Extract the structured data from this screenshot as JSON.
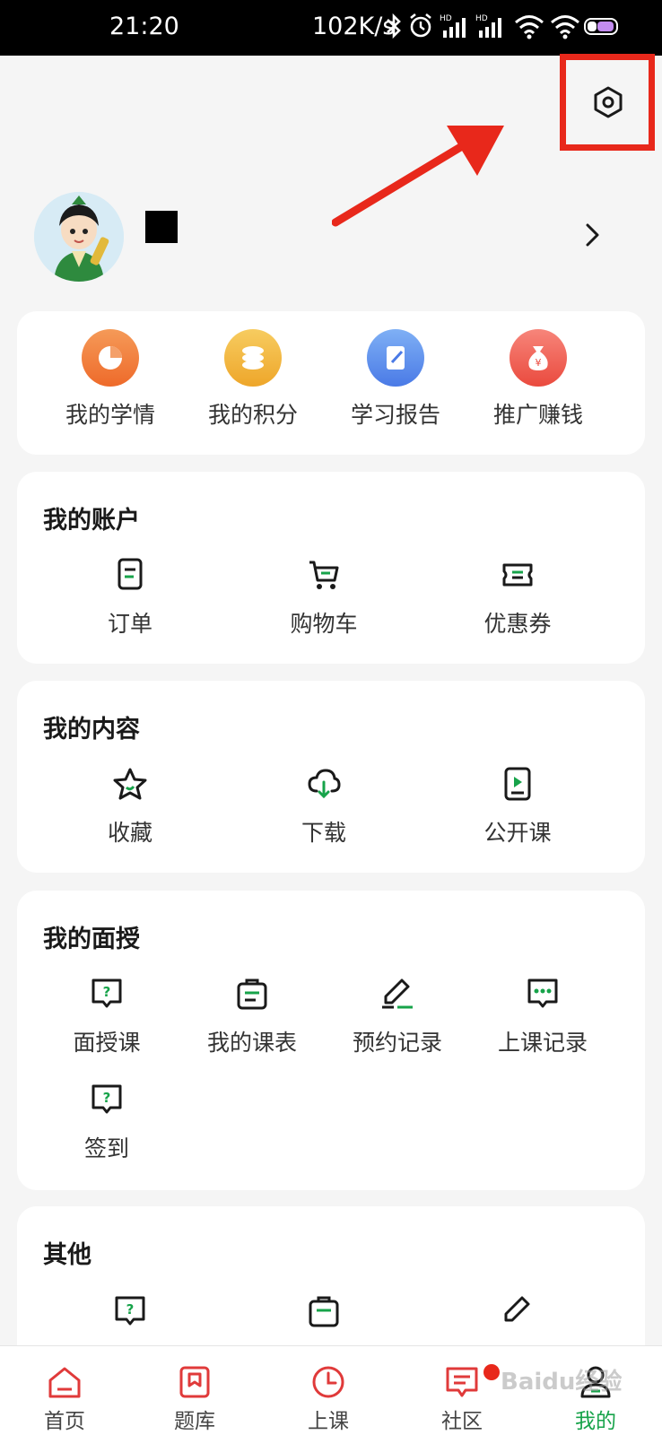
{
  "status_bar": {
    "time": "21:20",
    "speed": "102K/s",
    "icons": [
      "bluetooth-icon",
      "alarm-icon",
      "hd-signal-icon",
      "hd-signal-icon",
      "wifi-icon",
      "wifi-icon",
      "battery-icon"
    ]
  },
  "header": {
    "settings_icon": "settings-hexagon-icon",
    "annotation_color": "#e8281b"
  },
  "quick_actions": [
    {
      "label": "我的学情",
      "icon": "pie-chart-icon",
      "color": "#f07a35"
    },
    {
      "label": "我的积分",
      "icon": "coins-stack-icon",
      "color": "#f0b43a"
    },
    {
      "label": "学习报告",
      "icon": "notebook-edit-icon",
      "color": "#4f8fe8"
    },
    {
      "label": "推广赚钱",
      "icon": "money-bag-icon",
      "color": "#f05a4a"
    }
  ],
  "account": {
    "title": "我的账户",
    "items": [
      {
        "label": "订单",
        "icon": "order-document-icon"
      },
      {
        "label": "购物车",
        "icon": "shopping-cart-icon"
      },
      {
        "label": "优惠券",
        "icon": "coupon-icon"
      }
    ]
  },
  "content": {
    "title": "我的内容",
    "items": [
      {
        "label": "收藏",
        "icon": "star-icon"
      },
      {
        "label": "下载",
        "icon": "cloud-download-icon"
      },
      {
        "label": "公开课",
        "icon": "video-play-icon"
      }
    ]
  },
  "face_teaching": {
    "title": "我的面授",
    "items": [
      {
        "label": "面授课",
        "icon": "question-bubble-icon"
      },
      {
        "label": "我的课表",
        "icon": "clipboard-schedule-icon"
      },
      {
        "label": "预约记录",
        "icon": "pen-edit-icon"
      },
      {
        "label": "上课记录",
        "icon": "chat-dots-icon"
      },
      {
        "label": "签到",
        "icon": "question-bubble-icon"
      }
    ]
  },
  "other": {
    "title": "其他"
  },
  "bottom_nav": {
    "items": [
      {
        "label": "首页",
        "icon": "home-icon"
      },
      {
        "label": "题库",
        "icon": "question-bank-icon"
      },
      {
        "label": "上课",
        "icon": "clock-icon"
      },
      {
        "label": "社区",
        "icon": "community-chat-icon"
      },
      {
        "label": "我的",
        "icon": "user-icon"
      }
    ],
    "active": "我的",
    "active_color": "#17a34a",
    "nav_color": "#e03a3a"
  },
  "watermark": "Baidu经验"
}
